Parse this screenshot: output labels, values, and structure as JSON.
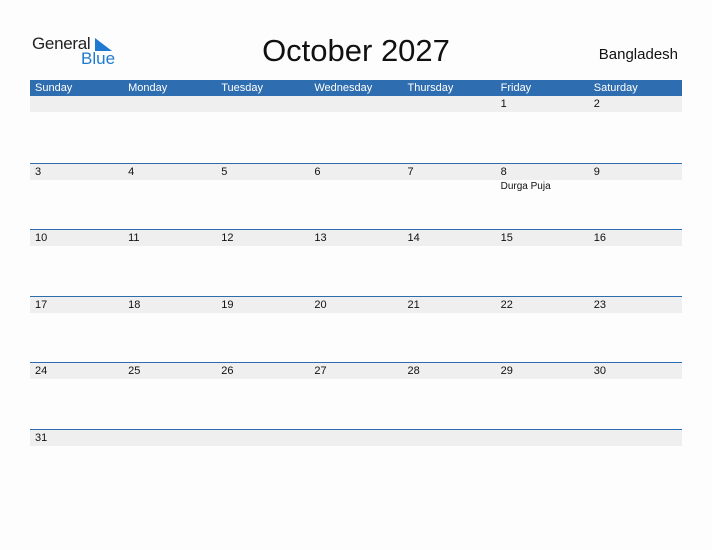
{
  "logo": {
    "general": "General",
    "blue": "Blue"
  },
  "title": "October 2027",
  "country": "Bangladesh",
  "colors": {
    "accent": "#2e6db0",
    "logo_blue": "#1f7ad0",
    "day_bg": "#efefef"
  },
  "weekdays": [
    "Sunday",
    "Monday",
    "Tuesday",
    "Wednesday",
    "Thursday",
    "Friday",
    "Saturday"
  ],
  "weeks": [
    [
      {
        "n": ""
      },
      {
        "n": ""
      },
      {
        "n": ""
      },
      {
        "n": ""
      },
      {
        "n": ""
      },
      {
        "n": "1"
      },
      {
        "n": "2"
      }
    ],
    [
      {
        "n": "3"
      },
      {
        "n": "4"
      },
      {
        "n": "5"
      },
      {
        "n": "6"
      },
      {
        "n": "7"
      },
      {
        "n": "8",
        "e": "Durga Puja"
      },
      {
        "n": "9"
      }
    ],
    [
      {
        "n": "10"
      },
      {
        "n": "11"
      },
      {
        "n": "12"
      },
      {
        "n": "13"
      },
      {
        "n": "14"
      },
      {
        "n": "15"
      },
      {
        "n": "16"
      }
    ],
    [
      {
        "n": "17"
      },
      {
        "n": "18"
      },
      {
        "n": "19"
      },
      {
        "n": "20"
      },
      {
        "n": "21"
      },
      {
        "n": "22"
      },
      {
        "n": "23"
      }
    ],
    [
      {
        "n": "24"
      },
      {
        "n": "25"
      },
      {
        "n": "26"
      },
      {
        "n": "27"
      },
      {
        "n": "28"
      },
      {
        "n": "29"
      },
      {
        "n": "30"
      }
    ],
    [
      {
        "n": "31"
      },
      {
        "n": ""
      },
      {
        "n": ""
      },
      {
        "n": ""
      },
      {
        "n": ""
      },
      {
        "n": ""
      },
      {
        "n": ""
      }
    ]
  ]
}
